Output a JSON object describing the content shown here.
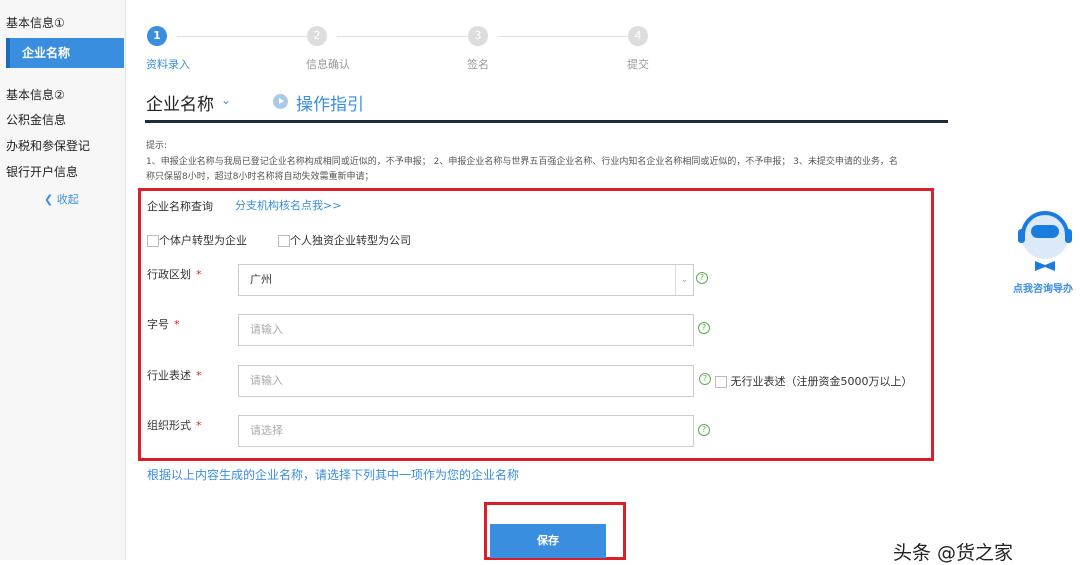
{
  "sidebar": {
    "group1": "基本信息①",
    "active": "企业名称",
    "items": [
      "基本信息②",
      "公积金信息",
      "办税和参保登记",
      "银行开户信息"
    ],
    "collapse": "收起"
  },
  "steps": [
    {
      "num": "1",
      "label": "资料录入"
    },
    {
      "num": "2",
      "label": "信息确认"
    },
    {
      "num": "3",
      "label": "签名"
    },
    {
      "num": "4",
      "label": "提交"
    }
  ],
  "section": {
    "title": "企业名称",
    "guide": "操作指引"
  },
  "hint": {
    "title": "提示:",
    "line1": "1、申报企业名称与我局已登记企业名称构成相同或近似的，不予申报； 2、申报企业名称与世界五百强企业名称、行业内知名企业名称相同或近似的，不予申报； 3、未提交申请的业务，名",
    "line2": "称只保留8小时，超过8小时名称将自动失效需重新申请；"
  },
  "form": {
    "query_label": "企业名称查询",
    "branch_link": "分支机构核名点我>>",
    "cb1": "个体户转型为企业",
    "cb2": "个人独资企业转型为公司",
    "region_label": "行政区划",
    "region_value": "广州",
    "zihao_label": "字号",
    "zihao_placeholder": "请输入",
    "industry_label": "行业表述",
    "industry_placeholder": "请输入",
    "no_industry": "无行业表述（注册资金5000万以上）",
    "org_label": "组织形式",
    "org_placeholder": "请选择",
    "required": "*",
    "help": "?"
  },
  "generated_text": "根据以上内容生成的企业名称，请选择下列其中一项作为您的企业名称",
  "save_label": "保存",
  "consult_label": "点我咨询导办",
  "watermark": "头条 @货之家"
}
